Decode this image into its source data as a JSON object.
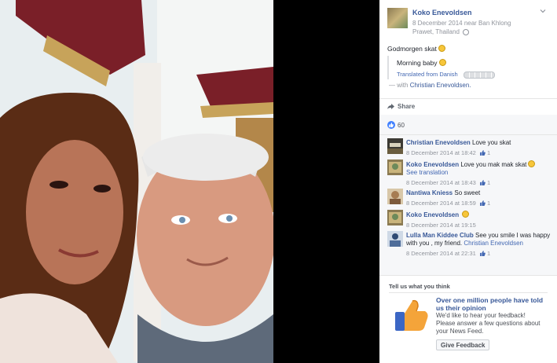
{
  "post": {
    "author": "Koko Enevoldsen",
    "meta": "8 December 2014 near Ban Khlong Prawet, Thailand",
    "text": "Godmorgen skat",
    "translation": "Morning baby",
    "translated_from": "Translated from Danish",
    "with_prefix": "— with",
    "with_name": "Christian Enevoldsen."
  },
  "actions": {
    "share_label": "Share",
    "likes_count": "60"
  },
  "comments": [
    {
      "author": "Christian Enevoldsen",
      "text": "Love you skat",
      "link": "",
      "time": "8 December 2014 at 18:42",
      "likes": "1"
    },
    {
      "author": "Koko Enevoldsen",
      "text": "Love you mak mak skat",
      "link": "See translation",
      "time": "8 December 2014 at 18:43",
      "likes": "1"
    },
    {
      "author": "Nantiwa Kniess",
      "text": "So sweet",
      "link": "",
      "time": "8 December 2014 at 18:59",
      "likes": "1"
    },
    {
      "author": "Koko Enevoldsen",
      "text": "",
      "link": "",
      "time": "8 December 2014 at 19:15",
      "likes": ""
    },
    {
      "author": "Lulla Man Kiddee Club",
      "text": "See you smile I was happy with you , my friend.",
      "link": "Christian Enevoldsen",
      "time": "8 December 2014 at 22:31",
      "likes": "1"
    }
  ],
  "survey": {
    "title": "Tell us what you think",
    "headline": "Over one million people have told us their opinion",
    "description": "We'd like to hear your feedback! Please answer a few questions about your News Feed.",
    "button": "Give Feedback"
  },
  "colors": {
    "link": "#385898",
    "like_blue": "#4080ff",
    "panel_gray": "#f6f7f9"
  }
}
